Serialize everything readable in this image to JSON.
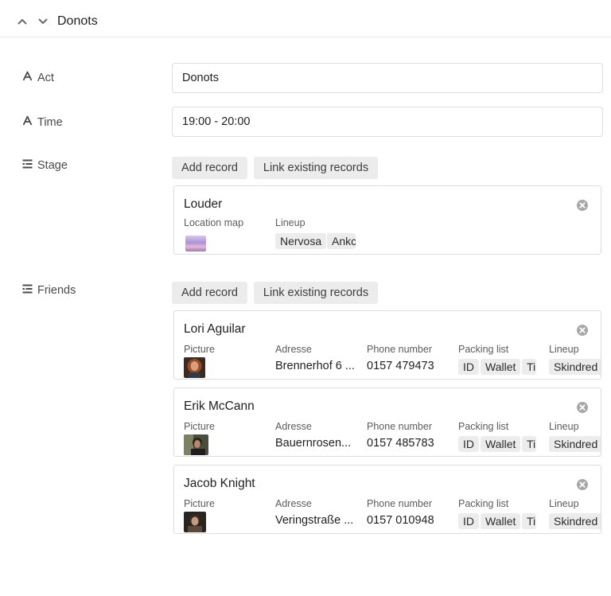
{
  "header": {
    "title": "Donots"
  },
  "fields": {
    "act": {
      "label": "Act",
      "value": "Donots"
    },
    "time": {
      "label": "Time",
      "value": "19:00 - 20:00"
    },
    "stage": {
      "label": "Stage",
      "add_record": "Add record",
      "link_existing": "Link existing records",
      "records": [
        {
          "title": "Louder",
          "columns": {
            "location_map": "Location map",
            "lineup": "Lineup"
          },
          "lineup": [
            "Nervosa",
            "Ankc"
          ]
        }
      ]
    },
    "friends": {
      "label": "Friends",
      "add_record": "Add record",
      "link_existing": "Link existing records",
      "columns": {
        "picture": "Picture",
        "adresse": "Adresse",
        "phone": "Phone number",
        "packing": "Packing list",
        "lineup": "Lineup"
      },
      "records": [
        {
          "name": "Lori Aguilar",
          "adresse": "Brennerhof 6 ...",
          "phone": "0157 479473",
          "packing": [
            "ID",
            "Wallet",
            "Ti"
          ],
          "lineup": "Skindred"
        },
        {
          "name": "Erik McCann",
          "adresse": "Bauernrosen...",
          "phone": "0157 485783",
          "packing": [
            "ID",
            "Wallet",
            "Ti"
          ],
          "lineup": "Skindred"
        },
        {
          "name": "Jacob Knight",
          "adresse": "Veringstraße ...",
          "phone": "0157 010948",
          "packing": [
            "ID",
            "Wallet",
            "Ti"
          ],
          "lineup": "Skindred"
        }
      ]
    }
  },
  "icons": {
    "prev": "chevron-up-icon",
    "next": "chevron-down-icon",
    "text_field": "text-field-icon",
    "linked_field": "linked-record-icon",
    "remove": "close-circle-icon"
  }
}
